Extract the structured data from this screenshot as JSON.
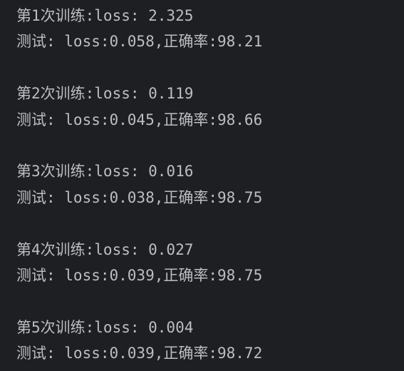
{
  "console": {
    "epochs": [
      {
        "train": "第1次训练:loss: 2.325",
        "test": "测试: loss:0.058,正确率:98.21"
      },
      {
        "train": "第2次训练:loss: 0.119",
        "test": "测试: loss:0.045,正确率:98.66"
      },
      {
        "train": "第3次训练:loss: 0.016",
        "test": "测试: loss:0.038,正确率:98.75"
      },
      {
        "train": "第4次训练:loss: 0.027",
        "test": "测试: loss:0.039,正确率:98.75"
      },
      {
        "train": "第5次训练:loss: 0.004",
        "test": "测试: loss:0.039,正确率:98.72"
      }
    ]
  },
  "colors": {
    "background": "#1e1f22",
    "text": "#bcbec4"
  }
}
